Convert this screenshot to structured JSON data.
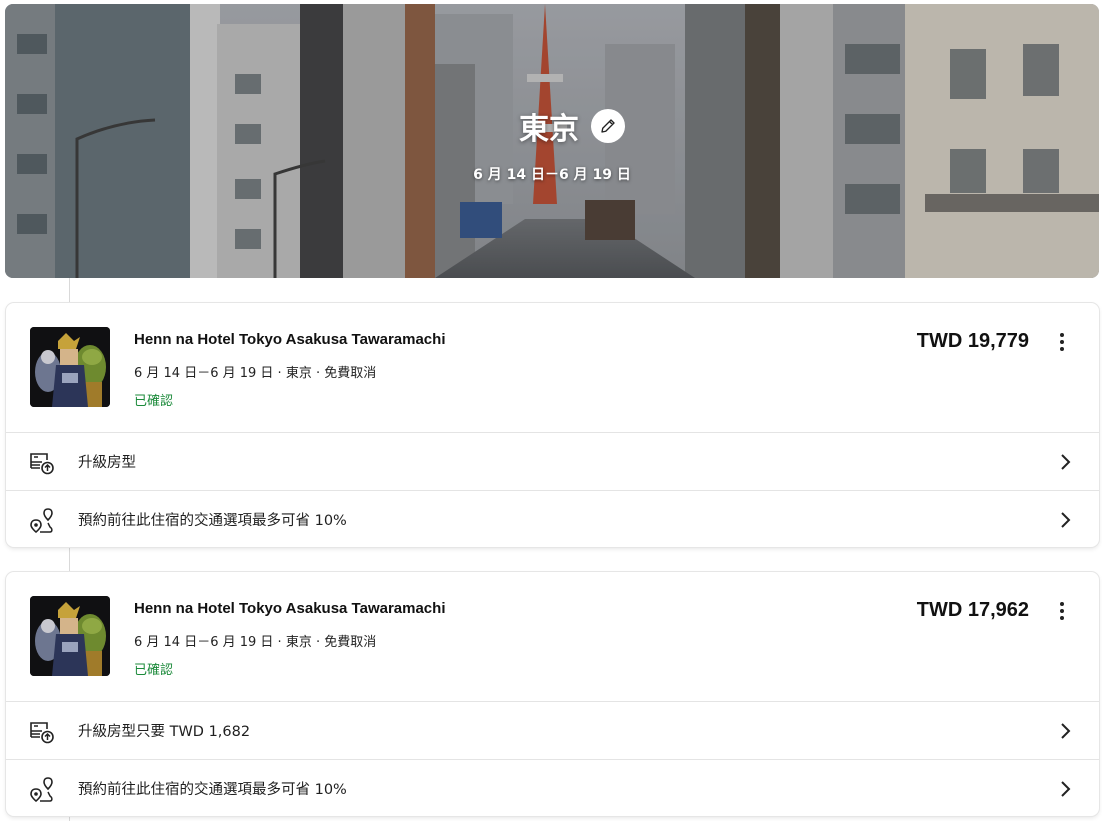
{
  "trip": {
    "title": "東京",
    "dates": "6 月 14 日－6 月 19 日"
  },
  "icons": {
    "edit": "pencil-icon",
    "more": "more-vertical-icon",
    "upgrade": "bed-upgrade-icon",
    "transport": "route-pin-icon",
    "chevron": "chevron-right-icon"
  },
  "colors": {
    "confirmed": "#1b8a3a",
    "text": "#1a1a1a"
  },
  "bookings": [
    {
      "hotel_name": "Henn na Hotel Tokyo Asakusa Tawaramachi",
      "meta": "6 月 14 日－6 月 19 日 · 東京 · 免費取消",
      "status": "已確認",
      "price": "TWD 19,779",
      "actions": [
        {
          "label": "升級房型"
        },
        {
          "label": "預約前往此住宿的交通選項最多可省 10%"
        }
      ]
    },
    {
      "hotel_name": "Henn na Hotel Tokyo Asakusa Tawaramachi",
      "meta": "6 月 14 日－6 月 19 日 · 東京 · 免費取消",
      "status": "已確認",
      "price": "TWD 17,962",
      "actions": [
        {
          "label": "升級房型只要 TWD 1,682"
        },
        {
          "label": "預約前往此住宿的交通選項最多可省 10%"
        }
      ]
    }
  ]
}
